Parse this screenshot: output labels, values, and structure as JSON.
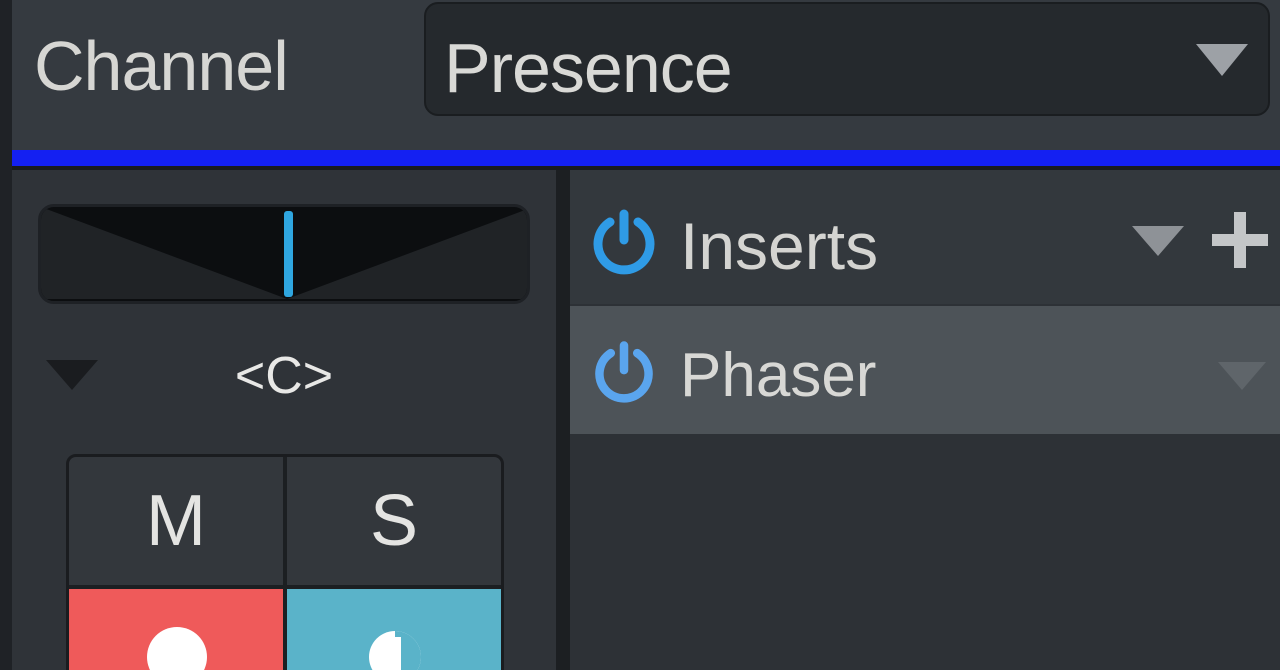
{
  "header": {
    "label": "Channel",
    "preset": "Presence"
  },
  "channel_strip": {
    "color": "#1420f2",
    "pan_value": "<C>",
    "buttons": {
      "mute": "M",
      "solo": "S"
    },
    "record_color": "#ef5a5a",
    "monitor_color": "#5ab3c9"
  },
  "inserts": {
    "title": "Inserts",
    "power_color": "#2f9be6",
    "slots": [
      {
        "name": "Phaser",
        "power_color": "#5aa5ee"
      }
    ]
  },
  "icons": {
    "power": "power-icon",
    "add": "plus-icon",
    "dropdown": "triangle-down-icon",
    "record": "record-dot-icon",
    "monitor": "monitor-icon"
  }
}
